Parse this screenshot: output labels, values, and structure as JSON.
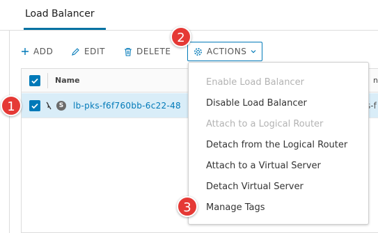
{
  "tab": {
    "label": "Load Balancer"
  },
  "toolbar": {
    "add_label": "ADD",
    "edit_label": "EDIT",
    "delete_label": "DELETE",
    "actions_label": "ACTIONS"
  },
  "table": {
    "columns": [
      "Name",
      "nm"
    ],
    "rows": [
      {
        "status_badge": "S",
        "name": "lb-pks-f6f760bb-6c22-48",
        "extra": "s-f",
        "selected": true
      }
    ]
  },
  "actions_menu": {
    "items": [
      {
        "label": "Enable Load Balancer",
        "enabled": false
      },
      {
        "label": "Disable Load Balancer",
        "enabled": true
      },
      {
        "label": "Attach to a Logical Router",
        "enabled": false
      },
      {
        "label": "Detach from the Logical Router",
        "enabled": true
      },
      {
        "label": "Attach to a Virtual Server",
        "enabled": true
      },
      {
        "label": "Detach Virtual Server",
        "enabled": true
      },
      {
        "label": "Manage Tags",
        "enabled": true
      }
    ]
  },
  "callouts": [
    "1",
    "2",
    "3"
  ],
  "colors": {
    "accent": "#0079b8",
    "selected_row": "#d9edf8",
    "callout": "#e53935",
    "tab_underline": "#0072a3"
  }
}
